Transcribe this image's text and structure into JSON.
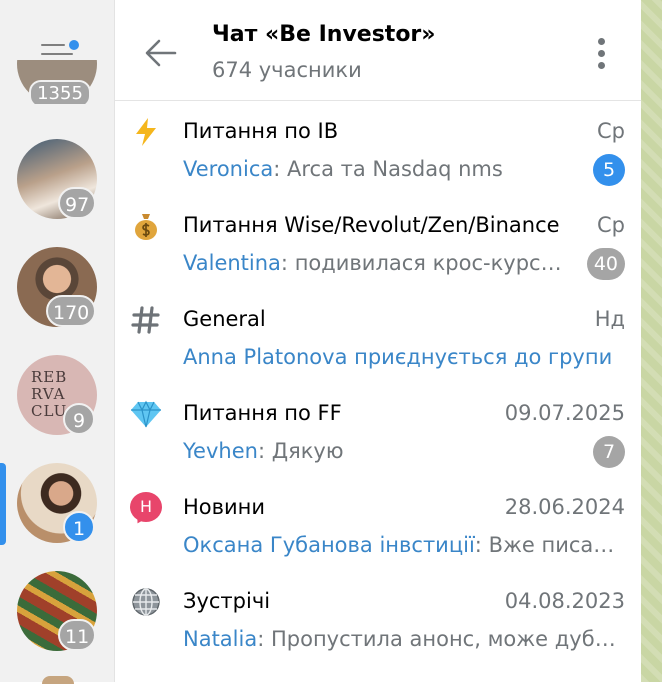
{
  "sidebar": {
    "top_partial_badge": "1355",
    "avatars": [
      {
        "badge": "97",
        "unread_style": "muted",
        "bg": "#c9b7a6"
      },
      {
        "badge": "170",
        "unread_style": "muted",
        "bg": "#8f6b55"
      },
      {
        "badge": "9",
        "unread_style": "muted",
        "bg": "#d8b0b0",
        "logo_lines": [
          "REB",
          "RVA",
          "CLU"
        ]
      },
      {
        "badge": "1",
        "unread_style": "unread",
        "bg": "#d7b08e"
      },
      {
        "badge": "11",
        "unread_style": "muted",
        "bg": "#a4442a"
      }
    ]
  },
  "header": {
    "title": "Чат «Be Investor»",
    "subtitle": "674 учасники"
  },
  "topics": [
    {
      "icon": "lightning-icon",
      "glyph": "⚡",
      "name": "Питання по IB",
      "date": "Ср",
      "sender": "Veronica",
      "message": "Arca та Nasdaq nms",
      "count": "5",
      "count_style": "unread"
    },
    {
      "icon": "money-bag-icon",
      "glyph": "💰",
      "name": "Питання Wise/Revolut/Zen/Binance",
      "date": "Ср",
      "sender": "Valentina",
      "message": "подивилася крос-курс валют в Revolut",
      "count": "40",
      "count_style": "muted"
    },
    {
      "icon": "hash-icon",
      "glyph": "#",
      "name": "General",
      "date": "Нд",
      "sender": "",
      "message": "",
      "system": "Anna Platonova приєднується до групи",
      "count": "",
      "count_style": ""
    },
    {
      "icon": "diamond-icon",
      "glyph": "💎",
      "name": "Питання по FF",
      "date": "09.07.2025",
      "sender": "Yevhen",
      "message": "Дякую",
      "count": "7",
      "count_style": "muted"
    },
    {
      "icon": "topic-letter-icon",
      "glyph": "Н",
      "name": "Новини",
      "date": "28.06.2024",
      "sender": "Оксана Губанова інвстиції",
      "message": "Вже писала про це",
      "count": "",
      "count_style": ""
    },
    {
      "icon": "globe-icon",
      "glyph": "",
      "name": "Зустрічі",
      "date": "04.08.2023",
      "sender": "Natalia",
      "message": "Пропустила анонс, може дублюватимете",
      "count": "",
      "count_style": ""
    }
  ],
  "colors": {
    "accent": "#3390ec",
    "muted_badge": "#a5a5a5",
    "sender": "#3a86c8",
    "secondary_text": "#707579"
  }
}
